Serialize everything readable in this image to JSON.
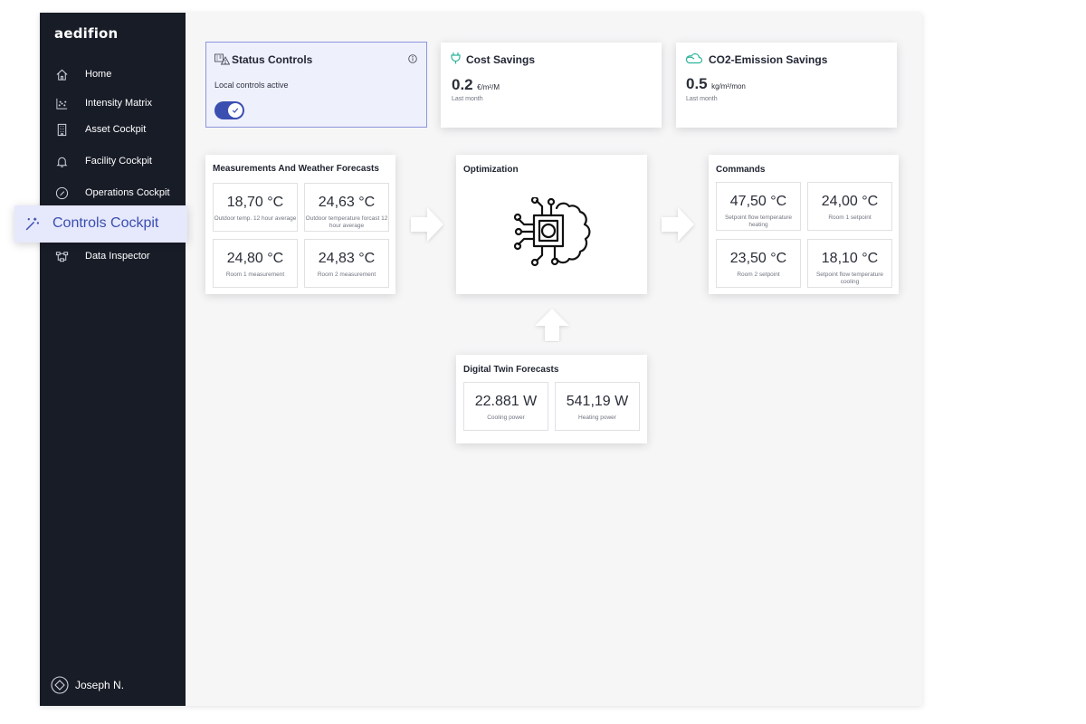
{
  "app": {
    "logo": "aedifion"
  },
  "sidebar": {
    "items": [
      {
        "label": "Home",
        "icon": "home-icon"
      },
      {
        "label": "Intensity Matrix",
        "icon": "chart-icon"
      },
      {
        "label": "Asset Cockpit",
        "icon": "building-icon"
      },
      {
        "label": "Facility Cockpit",
        "icon": "bell-icon"
      },
      {
        "label": "Operations Cockpit",
        "icon": "gauge-icon"
      },
      {
        "label": "Controls Cockpit",
        "icon": "magic-wand-icon",
        "active": true
      },
      {
        "label": "Data Inspector",
        "icon": "nodes-icon"
      }
    ],
    "user": "Joseph N."
  },
  "status_controls": {
    "title": "Status Controls",
    "status_text": "Local controls active",
    "toggle_on": true
  },
  "cost_savings": {
    "title": "Cost Savings",
    "value": "0.2",
    "unit": "€/m²/M",
    "period": "Last month"
  },
  "co2_savings": {
    "title": "CO2-Emission Savings",
    "value": "0.5",
    "unit": "kg/m²/mon",
    "period": "Last month"
  },
  "measurements": {
    "title": "Measurements And Weather Forecasts",
    "tiles": [
      {
        "value": "18,70 °C",
        "caption": "Outdoor temp. 12 hour average"
      },
      {
        "value": "24,63 °C",
        "caption": "Outdoor temperature forcast 12 hour average"
      },
      {
        "value": "24,80 °C",
        "caption": "Room 1 measurement"
      },
      {
        "value": "24,83 °C",
        "caption": "Room 2 measurement"
      }
    ]
  },
  "optimization": {
    "title": "Optimization"
  },
  "commands": {
    "title": "Commands",
    "tiles": [
      {
        "value": "47,50 °C",
        "caption": "Setpoint flow temperature heating"
      },
      {
        "value": "24,00 °C",
        "caption": "Room 1 setpoint"
      },
      {
        "value": "23,50 °C",
        "caption": "Room 2 setpoint"
      },
      {
        "value": "18,10 °C",
        "caption": "Setpoint flow temperature cooling"
      }
    ]
  },
  "digital_twin": {
    "title": "Digital Twin Forecasts",
    "tiles": [
      {
        "value": "22.881 W",
        "caption": "Cooling power"
      },
      {
        "value": "541,19 W",
        "caption": "Heating power"
      }
    ]
  },
  "colors": {
    "sidebar_bg": "#181c27",
    "accent": "#3a4fb0",
    "accent_light": "#e6e8fb",
    "green": "#2bb39a"
  }
}
